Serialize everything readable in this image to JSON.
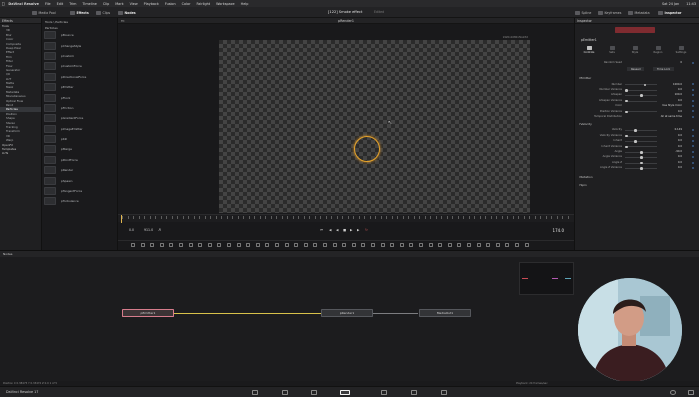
{
  "menubar": {
    "items": [
      "DaVinci Resolve",
      "File",
      "Edit",
      "Trim",
      "Timeline",
      "Clip",
      "Mark",
      "View",
      "Playback",
      "Fusion",
      "Color",
      "Fairlight",
      "Workspace",
      "Help"
    ],
    "date": "Sat 24 Jan",
    "time": "11:43"
  },
  "toolbar": {
    "media_pool": "Media Pool",
    "effects": "Effects",
    "clips": "Clips",
    "nodes": "Nodes",
    "project_title": "[122] Smoke effect",
    "project_status": "Edited",
    "spline": "Spline",
    "keyframes": "Keyframes",
    "metadata": "Metadata",
    "inspector": "Inspector"
  },
  "effects_panel": {
    "title": "Effects",
    "tree": [
      {
        "label": "Tools",
        "top": true
      },
      {
        "label": "3D"
      },
      {
        "label": "Blur"
      },
      {
        "label": "Color"
      },
      {
        "label": "Composite"
      },
      {
        "label": "Deep Pixel"
      },
      {
        "label": "Effect"
      },
      {
        "label": "Film"
      },
      {
        "label": "Filter"
      },
      {
        "label": "Flow"
      },
      {
        "label": "Generator"
      },
      {
        "label": "I/O"
      },
      {
        "label": "LUT"
      },
      {
        "label": "Matte"
      },
      {
        "label": "Mask"
      },
      {
        "label": "Metadata"
      },
      {
        "label": "Miscellaneous"
      },
      {
        "label": "Optical Flow"
      },
      {
        "label": "Paint"
      },
      {
        "label": "Particles",
        "sel": true
      },
      {
        "label": "Position"
      },
      {
        "label": "Shape"
      },
      {
        "label": "Stereo"
      },
      {
        "label": "Tracking"
      },
      {
        "label": "Transform"
      },
      {
        "label": "VR"
      },
      {
        "label": "Warp"
      },
      {
        "label": "OpenFX",
        "top": true
      },
      {
        "label": "Templates",
        "top": true
      },
      {
        "label": "LUTs",
        "top": true
      }
    ]
  },
  "tools_panel": {
    "breadcrumb": "Tools \\ Particles",
    "title": "Particles",
    "items": [
      "pBounce",
      "pChangeStyle",
      "pCustom",
      "pCustomForce",
      "pDirectionalForce",
      "pEmitter",
      "pFlock",
      "pFriction",
      "pGradientForce",
      "pImageEmitter",
      "pKill",
      "pMerge",
      "pPointForce",
      "pRender",
      "pSpawn",
      "pTangentForce",
      "pTurbulence"
    ]
  },
  "viewer": {
    "zoom": "Fit",
    "name": "pRender1",
    "resolution": "1920x1080xfloat32",
    "start_frame": "0.0",
    "end_frame": "911.0",
    "current_frame": "174.0"
  },
  "inspector": {
    "panel_title": "Inspector",
    "node_name": "pEmitter1",
    "tabs": [
      "Controls",
      "Sets",
      "Style",
      "Region",
      "Settings"
    ],
    "active_tab": "Controls",
    "random_seed": {
      "label": "Random Seed",
      "value": "0"
    },
    "buttons": [
      "Reseed",
      "Time Lock"
    ],
    "emitter": {
      "title": "Emitter",
      "rows": [
        {
          "label": "Number",
          "value": "1000.0",
          "frac": 0.62
        },
        {
          "label": "Number Variance",
          "value": "0.0",
          "frac": 0.0
        },
        {
          "label": "Lifespan",
          "value": "100.0",
          "frac": 0.5
        },
        {
          "label": "Lifespan Variance",
          "value": "0.0",
          "frac": 0.0
        },
        {
          "label": "Color",
          "value": "Use Style Color"
        },
        {
          "label": "Position Variance",
          "value": "0.0",
          "frac": 0.0
        },
        {
          "label": "Temporal Distribution",
          "value": "All at same time"
        }
      ]
    },
    "velocity": {
      "title": "Velocity",
      "rows": [
        {
          "label": "Velocity",
          "value": "0.149",
          "frac": 0.3
        },
        {
          "label": "Velocity Variance",
          "value": "0.0",
          "frac": 0.0
        },
        {
          "label": "Inherit",
          "value": "0.0",
          "frac": 0.3
        },
        {
          "label": "Inherit Variance",
          "value": "0.0",
          "frac": 0.0
        },
        {
          "label": "Angle",
          "value": "-90.0",
          "frac": 0.5
        },
        {
          "label": "Angle Variance",
          "value": "0.0",
          "frac": 0.5
        },
        {
          "label": "Angle Z",
          "value": "0.0",
          "frac": 0.5
        },
        {
          "label": "Angle Z Variance",
          "value": "0.0",
          "frac": 0.5
        }
      ]
    },
    "rotation": "Rotation",
    "spin": "Spin"
  },
  "nodes": {
    "title": "Nodes",
    "emitter": "pEmitter1",
    "render": "pRender1",
    "media_out": "MediaOut1"
  },
  "statusbar": {
    "left": "Position  X 0.38475   Y 0.33472   Z 0.0   1 of 5",
    "right": "Playback: 24 frames/sec"
  },
  "pagebar": {
    "brand": "DaVinci Resolve 17"
  }
}
